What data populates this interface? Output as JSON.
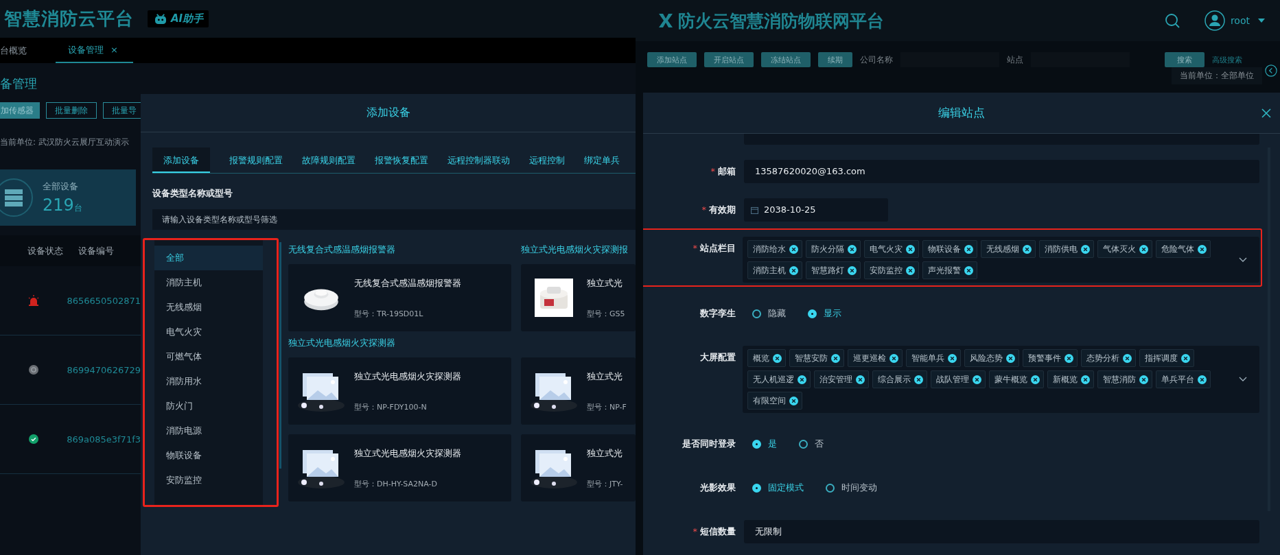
{
  "left_app": {
    "logo": "智慧消防云平台",
    "ai_badge": "AI助手",
    "tabs": [
      {
        "label": "台概览",
        "selected": false
      },
      {
        "label": "设备管理",
        "selected": true,
        "close": "×"
      }
    ],
    "page_title": "备管理",
    "buttons": [
      {
        "label": "加传感器",
        "primary": true
      },
      {
        "label": "批量删除",
        "primary": false
      },
      {
        "label": "批量导",
        "primary": false
      }
    ],
    "current_unit": "当前单位: 武汉防火云展厅互动演示",
    "summary_card": {
      "label": "全部设备",
      "count": "219",
      "unit": "台"
    },
    "table": {
      "columns": [
        "设备状态",
        "设备编号"
      ],
      "rows": [
        {
          "kind": "alarm",
          "id": "8656650502871"
        },
        {
          "kind": "offline",
          "id": "8699470626729"
        },
        {
          "kind": "online",
          "id": "869a085e3f71f3"
        }
      ]
    },
    "add_device_dialog": {
      "title": "添加设备",
      "tabs": [
        {
          "label": "添加设备",
          "selected": true
        },
        {
          "label": "报警规则配置",
          "selected": false
        },
        {
          "label": "故障规则配置",
          "selected": false
        },
        {
          "label": "报警恢复配置",
          "selected": false
        },
        {
          "label": "远程控制器联动",
          "selected": false
        },
        {
          "label": "远程控制",
          "selected": false
        },
        {
          "label": "绑定单兵",
          "selected": false
        }
      ],
      "filter_label": "设备类型名称或型号",
      "filter_placeholder": "请输入设备类型名称或型号筛选",
      "categories": {
        "highlighted": true,
        "items": [
          {
            "label": "全部",
            "selected": true
          },
          {
            "label": "消防主机",
            "selected": false
          },
          {
            "label": "无线感烟",
            "selected": false
          },
          {
            "label": "电气火灾",
            "selected": false
          },
          {
            "label": "可燃气体",
            "selected": false
          },
          {
            "label": "消防用水",
            "selected": false
          },
          {
            "label": "防火门",
            "selected": false
          },
          {
            "label": "消防电源",
            "selected": false
          },
          {
            "label": "物联设备",
            "selected": false
          },
          {
            "label": "安防监控",
            "selected": false
          }
        ]
      },
      "groups": [
        {
          "title": "无线复合式感温感烟报警器",
          "devices": [
            {
              "kind": "detector",
              "name": "无线复合式感温感烟报警器",
              "model": "型号：TR-19SD01L"
            }
          ]
        },
        {
          "title": "独立式光电感烟火灾探测报",
          "devices": [
            {
              "kind": "photo",
              "name": "独立式光",
              "model": "型号：GS5"
            }
          ]
        },
        {
          "title": "独立式光电感烟火灾探测器",
          "devices": [
            {
              "kind": "placeholder",
              "name": "独立式光电感烟火灾探测器",
              "model": "型号：NP-FDY100-N"
            },
            {
              "kind": "placeholder",
              "name": "独立式光",
              "model": "型号：NP-F"
            },
            {
              "kind": "placeholder",
              "name": "独立式光电感烟火灾探测器",
              "model": "型号：DH-HY-SA2NA-D"
            },
            {
              "kind": "placeholder",
              "name": "独立式光",
              "model": "型号：JTY-"
            }
          ]
        }
      ]
    }
  },
  "right_app": {
    "logo": "防火云智慧消防物联网平台",
    "user": "root",
    "toolbar": {
      "buttons": [
        "添加站点",
        "开启站点",
        "冻结站点",
        "续期"
      ],
      "fields": [
        {
          "label": "公司名称"
        },
        {
          "label": "站点"
        }
      ],
      "search_button": "搜索",
      "advanced_search": "高级搜索",
      "current_unit": "当前单位：全部单位"
    },
    "edit_dialog": {
      "title": "编辑站点",
      "fields": [
        {
          "kind": "blank"
        },
        {
          "kind": "text",
          "required_mark": "*",
          "label": "邮箱",
          "value": "13587620020@163.com"
        },
        {
          "kind": "date",
          "required_mark": "*",
          "label": "有效期",
          "value": "2038-10-25"
        },
        {
          "kind": "tags",
          "required_mark": "*",
          "label": "站点栏目",
          "highlighted": true,
          "tags": [
            "消防给水",
            "防火分隔",
            "电气火灾",
            "物联设备",
            "无线感烟",
            "消防供电",
            "气体灭火",
            "危险气体",
            "消防主机",
            "智慧路灯",
            "安防监控",
            "声光报警"
          ]
        },
        {
          "kind": "radio",
          "label": "数字孪生",
          "options": [
            {
              "label": "隐藏",
              "selected": false
            },
            {
              "label": "显示",
              "selected": true
            }
          ]
        },
        {
          "kind": "tags",
          "label": "大屏配置",
          "highlighted": false,
          "tags": [
            "概览",
            "智慧安防",
            "巡更巡检",
            "智能单兵",
            "风险态势",
            "预警事件",
            "态势分析",
            "指挥调度",
            "无人机巡逻",
            "治安管理",
            "综合展示",
            "战队管理",
            "蒙牛概览",
            "新概览",
            "智慧消防",
            "单兵平台",
            "有限空间"
          ]
        },
        {
          "kind": "radio",
          "label": "是否同时登录",
          "options": [
            {
              "label": "是",
              "selected": true
            },
            {
              "label": "否",
              "selected": false
            }
          ]
        },
        {
          "kind": "radio",
          "label": "光影效果",
          "options": [
            {
              "label": "固定模式",
              "selected": true
            },
            {
              "label": "时间变动",
              "selected": false
            }
          ]
        },
        {
          "kind": "text",
          "required_mark": "*",
          "label": "短信数量",
          "value": "无限制"
        },
        {
          "kind": "blank"
        }
      ]
    }
  }
}
